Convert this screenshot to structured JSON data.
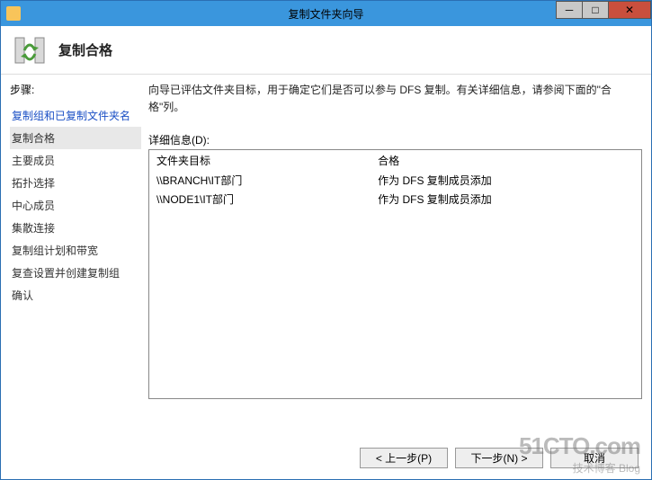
{
  "window": {
    "title": "复制文件夹向导"
  },
  "header": {
    "title": "复制合格"
  },
  "steps": {
    "label": "步骤:",
    "items": [
      {
        "label": "复制组和已复制文件夹名",
        "link": true
      },
      {
        "label": "复制合格",
        "active": true
      },
      {
        "label": "主要成员"
      },
      {
        "label": "拓扑选择"
      },
      {
        "label": "中心成员"
      },
      {
        "label": "集散连接"
      },
      {
        "label": "复制组计划和带宽"
      },
      {
        "label": "复查设置并创建复制组"
      },
      {
        "label": "确认"
      }
    ]
  },
  "content": {
    "description": "向导已评估文件夹目标，用于确定它们是否可以参与 DFS 复制。有关详细信息，请参阅下面的\"合格\"列。",
    "detail_label": "详细信息(D):",
    "columns": {
      "c1": "文件夹目标",
      "c2": "合格"
    },
    "rows": [
      {
        "target": "\\\\BRANCH\\IT部门",
        "status": "作为 DFS 复制成员添加"
      },
      {
        "target": "\\\\NODE1\\IT部门",
        "status": "作为 DFS 复制成员添加"
      }
    ]
  },
  "footer": {
    "prev": "< 上一步(P)",
    "next": "下一步(N) >",
    "cancel": "取消"
  },
  "watermark": {
    "big": "51CTO.com",
    "small": "技术博客 Blog"
  }
}
